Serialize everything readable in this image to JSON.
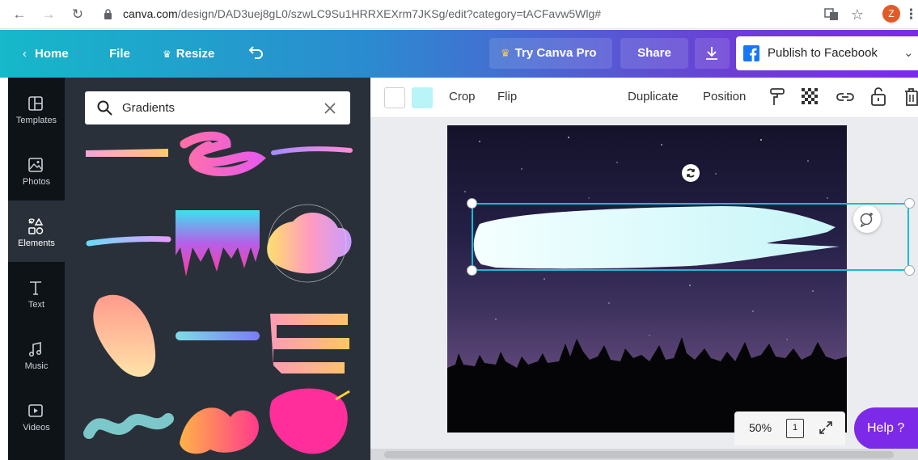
{
  "browser": {
    "url_host": "canva.com",
    "url_path": "/design/DAD3uej8gL0/szwLC9Su1HRRXEXrm7JKSg/edit?category=tACFavw5Wlg#",
    "avatar_letter": "Z"
  },
  "header": {
    "home_label": "Home",
    "file_label": "File",
    "resize_label": "Resize",
    "try_pro_label": "Try Canva Pro",
    "share_label": "Share",
    "publish_label": "Publish to Facebook"
  },
  "rail": {
    "items": [
      {
        "label": "Templates",
        "icon": "templates-icon"
      },
      {
        "label": "Photos",
        "icon": "photos-icon"
      },
      {
        "label": "Elements",
        "icon": "elements-icon",
        "active": true
      },
      {
        "label": "Text",
        "icon": "text-icon"
      },
      {
        "label": "Music",
        "icon": "music-icon"
      },
      {
        "label": "Videos",
        "icon": "videos-icon"
      }
    ]
  },
  "panel": {
    "search_value": "Gradients"
  },
  "toolbar": {
    "color_1": "#ffffff",
    "color_2": "#b8f4f8",
    "crop_label": "Crop",
    "flip_label": "Flip",
    "duplicate_label": "Duplicate",
    "position_label": "Position"
  },
  "canvas": {
    "zoom_label": "50%",
    "page_count": "1",
    "help_label": "Help ?"
  },
  "colors": {
    "accent": "#7d2ae8",
    "selection": "#17bdd4",
    "panel_bg": "#293039"
  }
}
